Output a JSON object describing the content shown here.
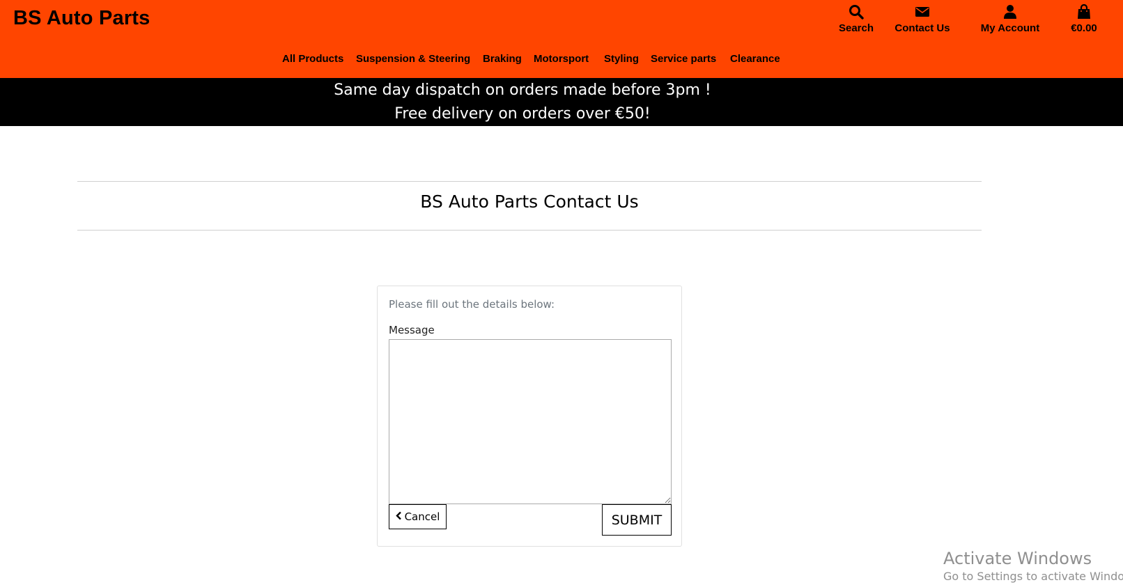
{
  "header": {
    "logo": "BS Auto Parts",
    "links": [
      {
        "label": "Search",
        "icon": "search-icon"
      },
      {
        "label": "Contact Us",
        "icon": "envelope-icon"
      },
      {
        "label": "My Account",
        "icon": "user-icon"
      },
      {
        "label": "€0.00",
        "icon": "shopping-bag-icon"
      }
    ],
    "nav": [
      "All Products",
      "Suspension & Steering",
      "Braking",
      "Motorsport",
      "Styling",
      "Service parts",
      "Clearance"
    ],
    "colors": {
      "header_bg": "#ff4500",
      "promo_bg": "#000000"
    }
  },
  "promo": {
    "line1": "Same day dispatch on orders made before 3pm !",
    "line2": "Free delivery on orders over €50!"
  },
  "main": {
    "title": "BS Auto Parts Contact Us",
    "form": {
      "instructions": "Please fill out the details below:",
      "message_label": "Message",
      "message_value": "",
      "cancel_label": "Cancel",
      "submit_label": "SUBMIT"
    }
  },
  "watermark": {
    "line1": "Activate Windows",
    "line2": "Go to Settings to activate Windows."
  }
}
